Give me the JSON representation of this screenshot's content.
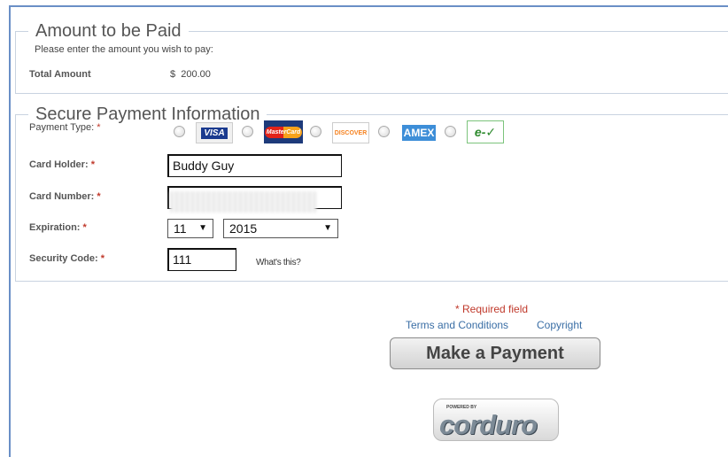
{
  "amount_section": {
    "legend": "Amount to be Paid",
    "instruction": "Please enter the amount you wish to pay:",
    "total_label": "Total Amount",
    "currency_symbol": "$",
    "total_value": "200.00"
  },
  "payment_section": {
    "legend": "Secure Payment Information",
    "payment_type_label": "Payment Type:",
    "required_marker": "*",
    "card_types": [
      {
        "name": "VISA",
        "icon": "visa-card-icon"
      },
      {
        "name": "MasterCard",
        "icon": "mastercard-card-icon"
      },
      {
        "name": "DISCOVER",
        "icon": "discover-card-icon"
      },
      {
        "name": "AMEX",
        "icon": "amex-card-icon"
      },
      {
        "name": "e-✓",
        "icon": "echeck-icon"
      }
    ],
    "card_holder_label": "Card Holder:",
    "card_holder_value": "Buddy Guy",
    "card_number_label": "Card Number:",
    "expiration_label": "Expiration:",
    "exp_month": "11",
    "exp_year": "2015",
    "security_code_label": "Security Code:",
    "security_code_value": "111",
    "whats_this": "What's this?"
  },
  "footer": {
    "required_note": "* Required field",
    "terms_link": "Terms and Conditions",
    "copyright_link": "Copyright",
    "submit_label": "Make a Payment",
    "powered_by": "POWERED BY",
    "logo_text": "corduro"
  },
  "colors": {
    "frame_border": "#6a8fc6",
    "required_red": "#c0392b",
    "link_blue": "#3a6ea5"
  }
}
